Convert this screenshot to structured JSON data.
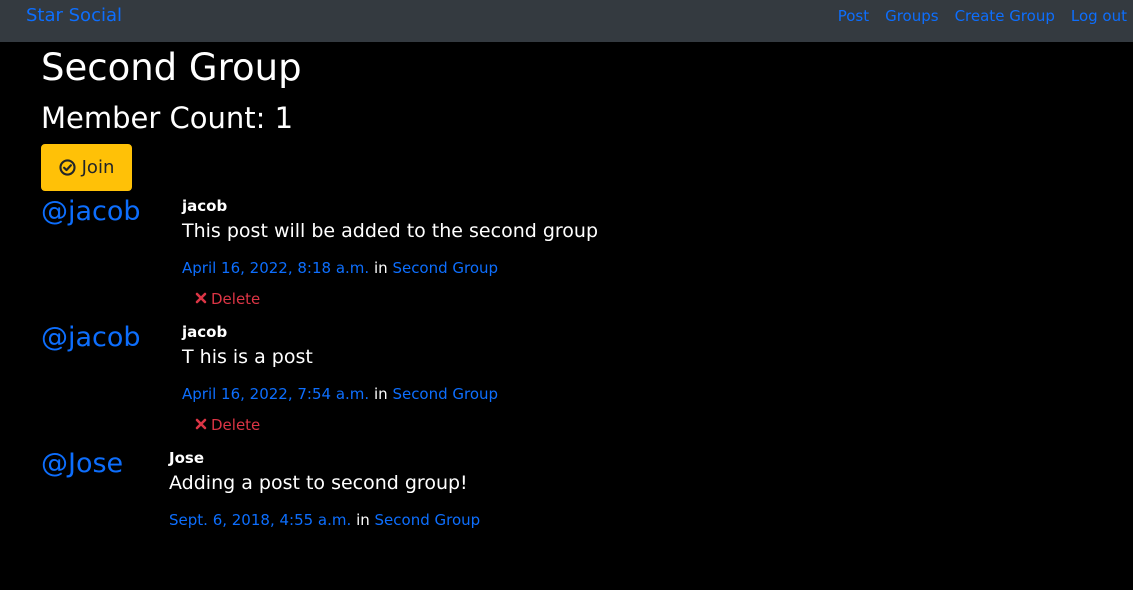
{
  "navbar": {
    "brand": "Star Social",
    "links": [
      "Post",
      "Groups",
      "Create Group",
      "Log out"
    ]
  },
  "group": {
    "name": "Second Group",
    "member_count_text": "Member Count: 1",
    "join_label": "Join"
  },
  "posts": [
    {
      "handle": "@jacob",
      "username": "jacob",
      "message": "This post will be added to the second group",
      "date": "April 16, 2022, 8:18 a.m.",
      "in_word": "in",
      "group": "Second Group",
      "delete_label": "Delete"
    },
    {
      "handle": "@jacob",
      "username": "jacob",
      "message": "T his is a post",
      "date": "April 16, 2022, 7:54 a.m.",
      "in_word": "in",
      "group": "Second Group",
      "delete_label": "Delete"
    },
    {
      "handle": "@Jose",
      "username": "Jose",
      "message": "Adding a post to second group!",
      "date": "Sept. 6, 2018, 4:55 a.m.",
      "in_word": "in",
      "group": "Second Group"
    }
  ],
  "colors": {
    "navbar_bg": "#343a40",
    "link": "#0d6efd",
    "join_button": "#ffc107",
    "delete": "#dc3545",
    "page_bg": "#000000"
  },
  "icons": {
    "join": "check-circle-icon",
    "delete": "x-icon"
  }
}
